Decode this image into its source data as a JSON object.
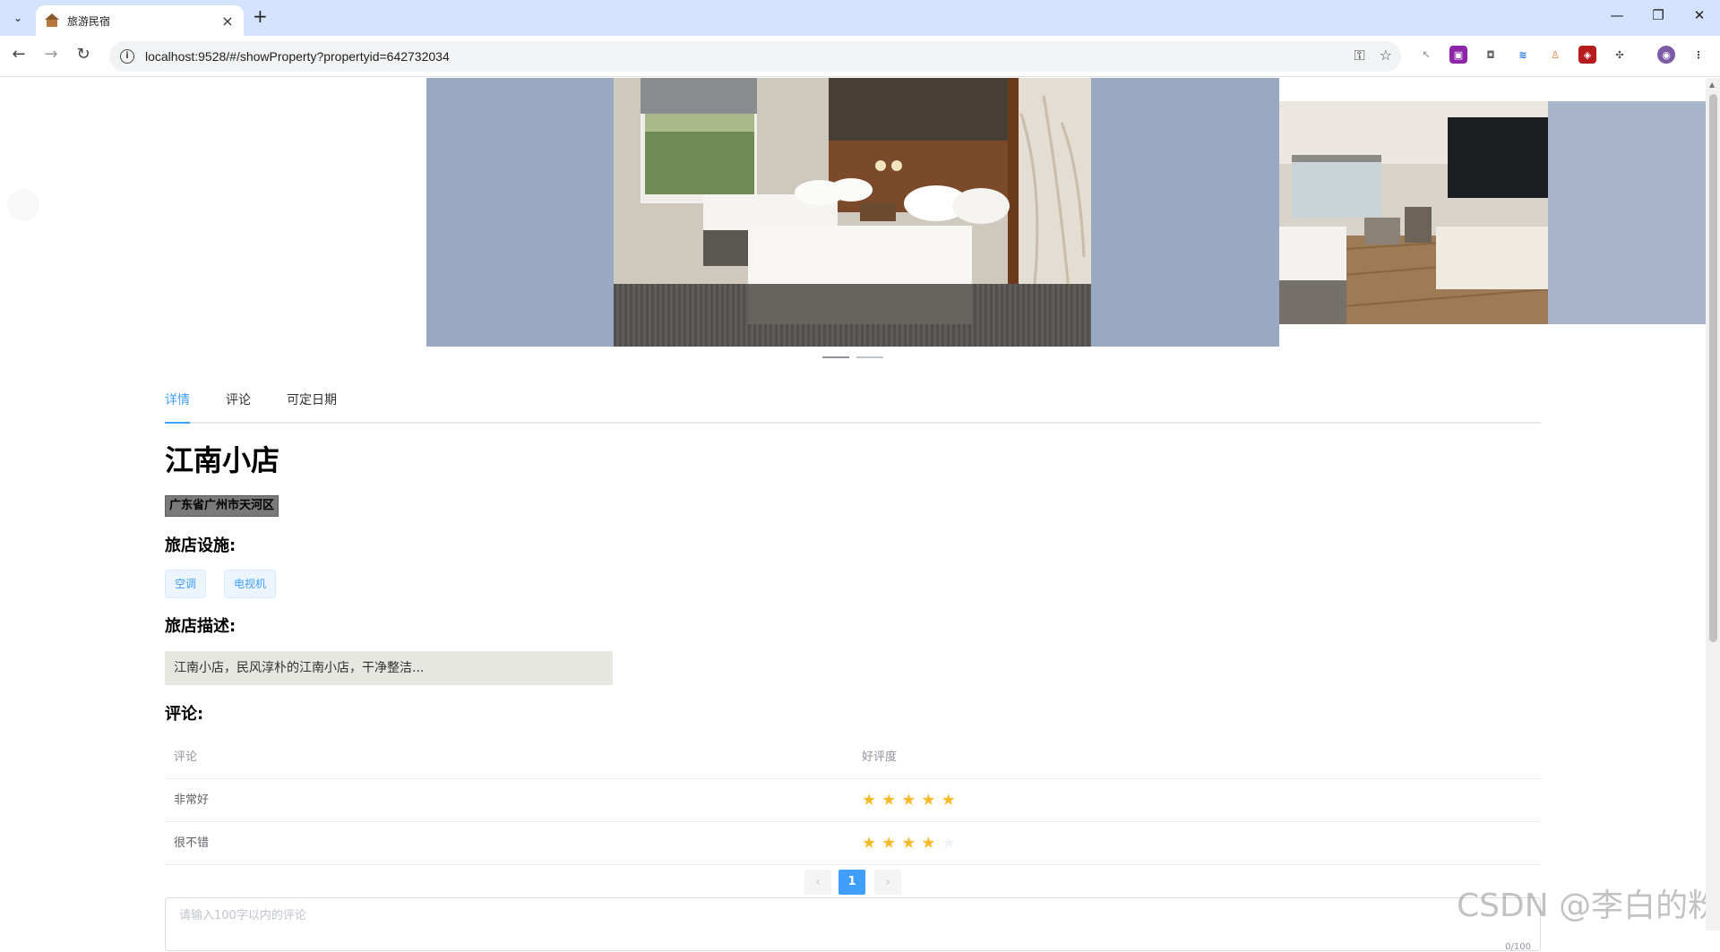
{
  "browser": {
    "tab_title": "旅游民宿",
    "url": "localhost:9528/#/showProperty?propertyid=642732034"
  },
  "tabs": [
    {
      "label": "详情",
      "active": true
    },
    {
      "label": "评论",
      "active": false
    },
    {
      "label": "可定日期",
      "active": false
    }
  ],
  "property": {
    "name": "江南小店",
    "address": "广东省广州市天河区",
    "facilities_heading": "旅店设施:",
    "facilities": [
      "空调",
      "电视机"
    ],
    "description_heading": "旅店描述:",
    "description": "江南小店，民风淳朴的江南小店，干净整洁..."
  },
  "comments": {
    "heading": "评论:",
    "columns": [
      "评论",
      "好评度"
    ],
    "rows": [
      {
        "comment": "非常好",
        "rating": 5
      },
      {
        "comment": "很不错",
        "rating": 4
      }
    ],
    "max_rating": 5
  },
  "pagination": {
    "current": "1",
    "prev": "‹",
    "next": "›"
  },
  "comment_input": {
    "placeholder": "请输入100字以内的评论",
    "counter": "0/100"
  },
  "watermark": "CSDN @李白的粉",
  "colors": {
    "accent": "#409eff",
    "star": "#f7ba2a"
  }
}
